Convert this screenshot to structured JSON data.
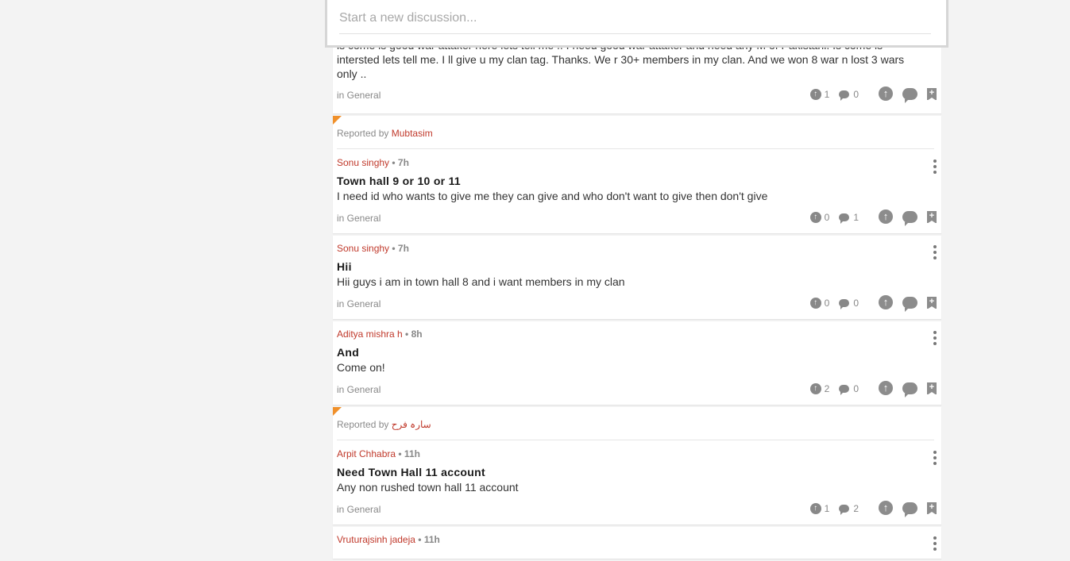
{
  "new_discussion": {
    "placeholder": "Start a new discussion..."
  },
  "first_card": {
    "body_partial_top": "is come is good war attaker here lets tell me .. I need good war attaker and need any M of Pakistani. Is come is",
    "body": "intersted lets tell me. I ll give u my clan tag. Thanks. We r 30+ members in my clan. And we won 8 war n lost 3 wars only ..",
    "category": "in General",
    "upvotes": "1",
    "comments": "0"
  },
  "reported_label": "Reported by",
  "posts": [
    {
      "reported_by": "Mubtasim",
      "author": "Sonu singhy",
      "time": "• 7h",
      "title": "Town hall 9 or 10 or 11",
      "body": "I need id who wants to give me they can give and who don't want to give then don't give",
      "category": "in General",
      "upvotes": "0",
      "comments": "1"
    },
    {
      "author": "Sonu singhy",
      "time": "• 7h",
      "title": "Hii",
      "body": "Hii guys i am in town hall 8 and i want members in my clan",
      "category": "in General",
      "upvotes": "0",
      "comments": "0"
    },
    {
      "author": "Aditya mishra h",
      "time": "• 8h",
      "title": "And",
      "body": "Come on!",
      "category": "in General",
      "upvotes": "2",
      "comments": "0"
    },
    {
      "reported_by": "سارہ فرح",
      "author": "Arpit Chhabra",
      "time": "• 11h",
      "title": "Need Town Hall 11 account",
      "body": "Any non rushed town hall 11 account",
      "category": "in General",
      "upvotes": "1",
      "comments": "2"
    },
    {
      "author": "Vruturajsinh jadeja",
      "time": "• 11h"
    }
  ],
  "icons": {
    "upvote": "upvote-icon",
    "comment": "comment-icon",
    "bookmark": "bookmark-icon",
    "more": "more-vertical-icon"
  },
  "colors": {
    "author": "#c0392b",
    "flag": "#f0902a",
    "icon": "#8c8c8c",
    "background": "#f3f3f3"
  }
}
